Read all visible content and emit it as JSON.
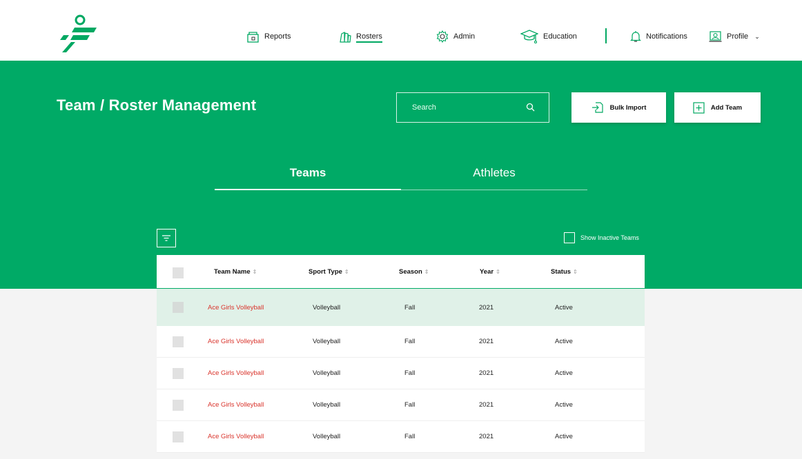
{
  "nav": {
    "reports": "Reports",
    "rosters": "Rosters",
    "admin": "Admin",
    "education": "Education",
    "notifications": "Notifications",
    "profile": "Profile"
  },
  "header": {
    "title": "Team / Roster Management",
    "search_placeholder": "Search",
    "bulk_import": "Bulk Import",
    "add_team": "Add Team"
  },
  "tabs": {
    "teams": "Teams",
    "athletes": "Athletes"
  },
  "filters": {
    "show_inactive": "Show Inactive Teams"
  },
  "table": {
    "columns": [
      "Team Name",
      "Sport Type",
      "Season",
      "Year",
      "Status"
    ],
    "rows": [
      [
        "Ace Girls Volleyball",
        "Volleyball",
        "Fall",
        "2021",
        "Active"
      ],
      [
        "Ace Girls Volleyball",
        "Volleyball",
        "Fall",
        "2021",
        "Active"
      ],
      [
        "Ace Girls Volleyball",
        "Volleyball",
        "Fall",
        "2021",
        "Active"
      ],
      [
        "Ace Girls Volleyball",
        "Volleyball",
        "Fall",
        "2021",
        "Active"
      ],
      [
        "Ace Girls Volleyball",
        "Volleyball",
        "Fall",
        "2021",
        "Active"
      ]
    ]
  },
  "colors": {
    "brand": "#00aa66",
    "link": "#d9332b",
    "selected_row": "#e0f1e8"
  },
  "icons": [
    "logo-icon",
    "reports-icon",
    "rosters-icon",
    "admin-gear-icon",
    "education-cap-icon",
    "bell-icon",
    "profile-icon",
    "chevron-down-icon",
    "search-icon",
    "import-icon",
    "plus-icon",
    "filter-icon",
    "sort-icon"
  ]
}
